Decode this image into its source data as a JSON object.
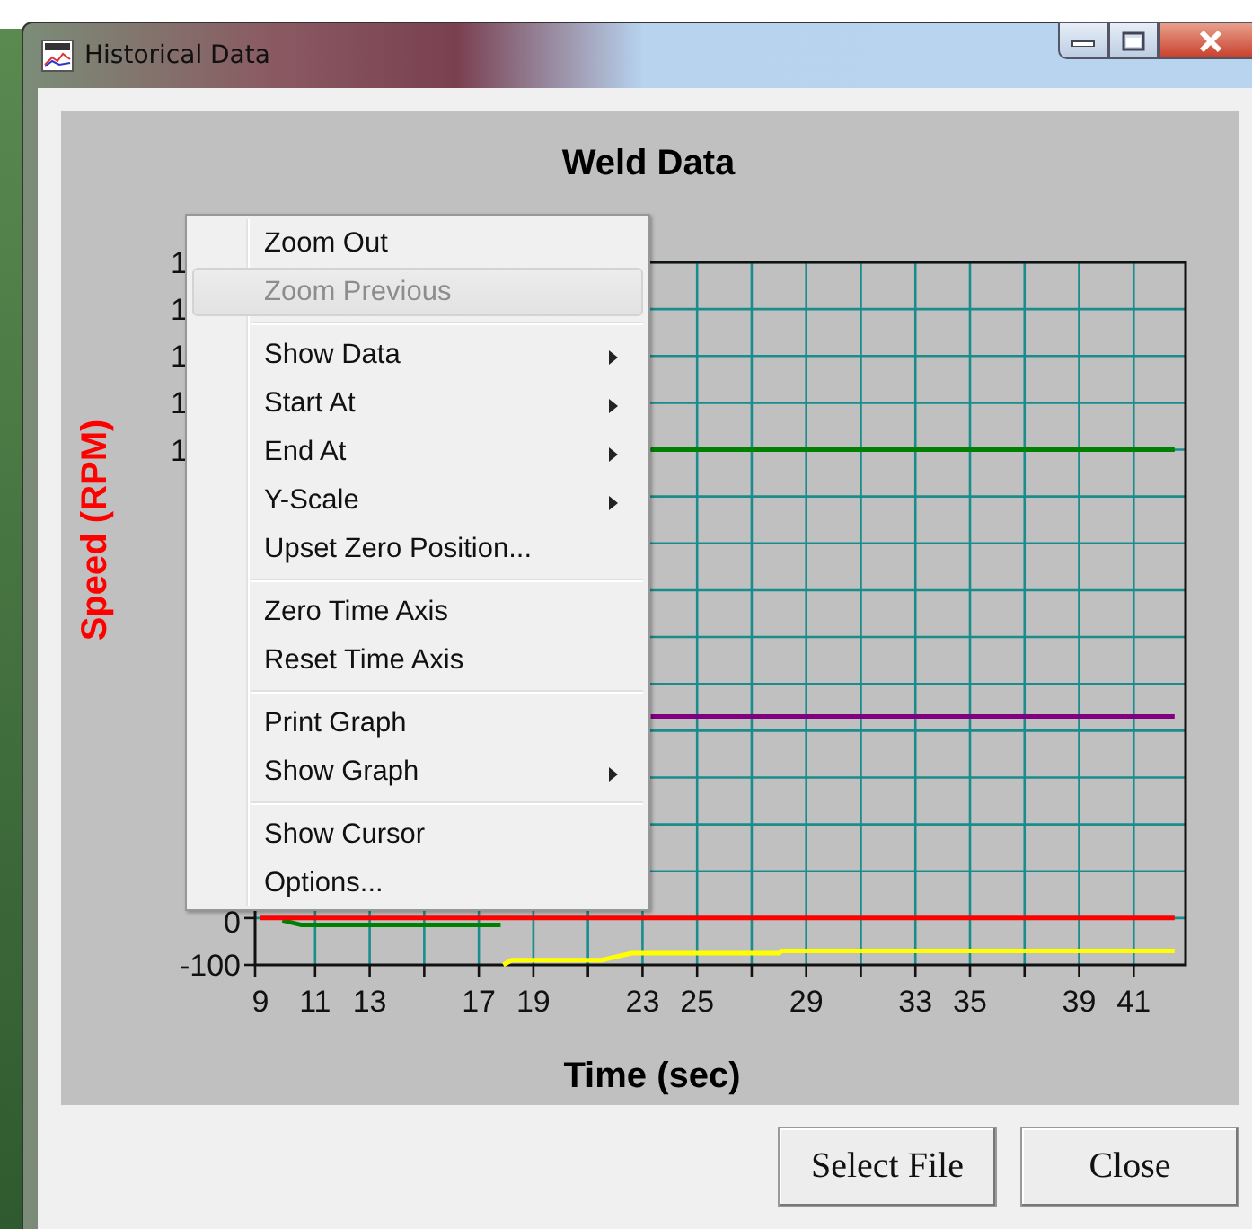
{
  "window": {
    "title": "Historical Data"
  },
  "chart": {
    "chart_data": {
      "type": "line",
      "title": "Weld Data",
      "xlabel": "Time (sec)",
      "ylabel": "Speed (RPM)",
      "x": [
        9,
        9.8,
        10.5,
        17.8,
        17.9,
        18.2,
        21.5,
        22.6,
        23.3,
        28,
        28.1,
        42.5
      ],
      "series": [
        {
          "color": "#008000",
          "values": [
            null,
            -5,
            -15,
            -15,
            null,
            null,
            null,
            null,
            1000,
            1000,
            1000,
            1000
          ]
        },
        {
          "color": "#ff0000",
          "values": [
            0,
            0,
            0,
            0,
            0,
            0,
            0,
            0,
            0,
            0,
            0,
            0
          ]
        },
        {
          "color": "#800080",
          "values": [
            null,
            null,
            null,
            null,
            null,
            null,
            null,
            null,
            430,
            430,
            430,
            430
          ]
        },
        {
          "color": "#ffff00",
          "values": [
            null,
            null,
            null,
            null,
            -100,
            -90,
            -90,
            -75,
            -75,
            -75,
            -70,
            -70
          ]
        }
      ],
      "grid": true,
      "xlim": [
        8.8,
        42.9
      ],
      "ylim": [
        -100,
        1400
      ],
      "xticks": [
        9,
        11,
        13,
        17,
        19,
        23,
        25,
        29,
        33,
        35,
        39,
        41
      ],
      "yticks": [
        0,
        -100
      ]
    },
    "partial_y_labels": [
      "1",
      "1",
      "1",
      "1",
      "1"
    ]
  },
  "context_menu": {
    "groups": [
      [
        {
          "label": "Zoom Out",
          "disabled": false,
          "highlighted": false,
          "submenu": false
        },
        {
          "label": "Zoom Previous",
          "disabled": true,
          "highlighted": true,
          "submenu": false
        }
      ],
      [
        {
          "label": "Show Data",
          "disabled": false,
          "highlighted": false,
          "submenu": true
        },
        {
          "label": "Start At",
          "disabled": false,
          "highlighted": false,
          "submenu": true
        },
        {
          "label": "End At",
          "disabled": false,
          "highlighted": false,
          "submenu": true
        },
        {
          "label": "Y-Scale",
          "disabled": false,
          "highlighted": false,
          "submenu": true
        },
        {
          "label": "Upset Zero Position...",
          "disabled": false,
          "highlighted": false,
          "submenu": false
        }
      ],
      [
        {
          "label": "Zero Time Axis",
          "disabled": false,
          "highlighted": false,
          "submenu": false
        },
        {
          "label": "Reset Time Axis",
          "disabled": false,
          "highlighted": false,
          "submenu": false
        }
      ],
      [
        {
          "label": "Print Graph",
          "disabled": false,
          "highlighted": false,
          "submenu": false
        },
        {
          "label": "Show Graph",
          "disabled": false,
          "highlighted": false,
          "submenu": true
        }
      ],
      [
        {
          "label": "Show Cursor",
          "disabled": false,
          "highlighted": false,
          "submenu": false
        },
        {
          "label": "Options...",
          "disabled": false,
          "highlighted": false,
          "submenu": false
        }
      ]
    ]
  },
  "buttons": [
    "Select File",
    "Close"
  ]
}
